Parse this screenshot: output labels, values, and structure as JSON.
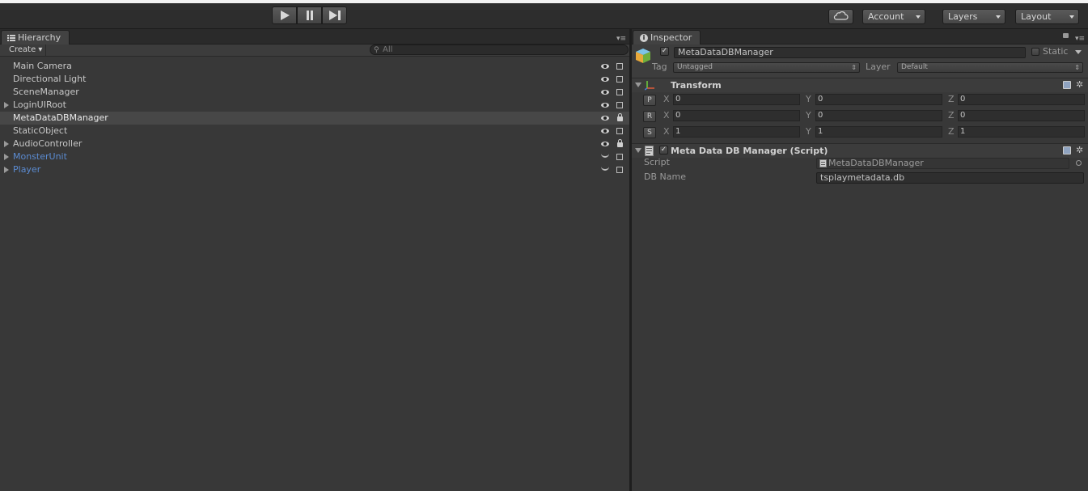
{
  "toolbar": {
    "play_icon": "play-icon",
    "pause_icon": "pause-icon",
    "step_icon": "step-icon",
    "cloud_icon": "cloud-icon",
    "account_label": "Account",
    "layers_label": "Layers",
    "layout_label": "Layout"
  },
  "hierarchy": {
    "tab_label": "Hierarchy",
    "create_label": "Create",
    "search_placeholder": "All",
    "items": [
      {
        "label": "Main Camera",
        "expandable": false,
        "prefab": false,
        "selected": false,
        "visible": true,
        "locked": false
      },
      {
        "label": "Directional Light",
        "expandable": false,
        "prefab": false,
        "selected": false,
        "visible": true,
        "locked": false
      },
      {
        "label": "SceneManager",
        "expandable": false,
        "prefab": false,
        "selected": false,
        "visible": true,
        "locked": false
      },
      {
        "label": "LoginUIRoot",
        "expandable": true,
        "prefab": false,
        "selected": false,
        "visible": true,
        "locked": false
      },
      {
        "label": "MetaDataDBManager",
        "expandable": false,
        "prefab": false,
        "selected": true,
        "visible": true,
        "locked": true
      },
      {
        "label": "StaticObject",
        "expandable": false,
        "prefab": false,
        "selected": false,
        "visible": true,
        "locked": false
      },
      {
        "label": "AudioController",
        "expandable": true,
        "prefab": false,
        "selected": false,
        "visible": true,
        "locked": true
      },
      {
        "label": "MonsterUnit",
        "expandable": true,
        "prefab": true,
        "selected": false,
        "visible": false,
        "locked": false
      },
      {
        "label": "Player",
        "expandable": true,
        "prefab": true,
        "selected": false,
        "visible": false,
        "locked": false
      }
    ]
  },
  "inspector": {
    "tab_label": "Inspector",
    "object_name": "MetaDataDBManager",
    "static_label": "Static",
    "tag_label": "Tag",
    "tag_value": "Untagged",
    "layer_label": "Layer",
    "layer_value": "Default",
    "transform": {
      "title": "Transform",
      "rows": [
        {
          "btn": "P",
          "x": "0",
          "y": "0",
          "z": "0"
        },
        {
          "btn": "R",
          "x": "0",
          "y": "0",
          "z": "0"
        },
        {
          "btn": "S",
          "x": "1",
          "y": "1",
          "z": "1"
        }
      ],
      "axis_x": "X",
      "axis_y": "Y",
      "axis_z": "Z"
    },
    "script_component": {
      "title": "Meta Data DB Manager (Script)",
      "script_label": "Script",
      "script_value": "MetaDataDBManager",
      "dbname_label": "DB Name",
      "dbname_value": "tsplaymetadata.db"
    }
  },
  "colors": {
    "background": "#222222",
    "panel": "#383838",
    "selected_row": "#474747",
    "prefab_text": "#5b8bd1"
  }
}
